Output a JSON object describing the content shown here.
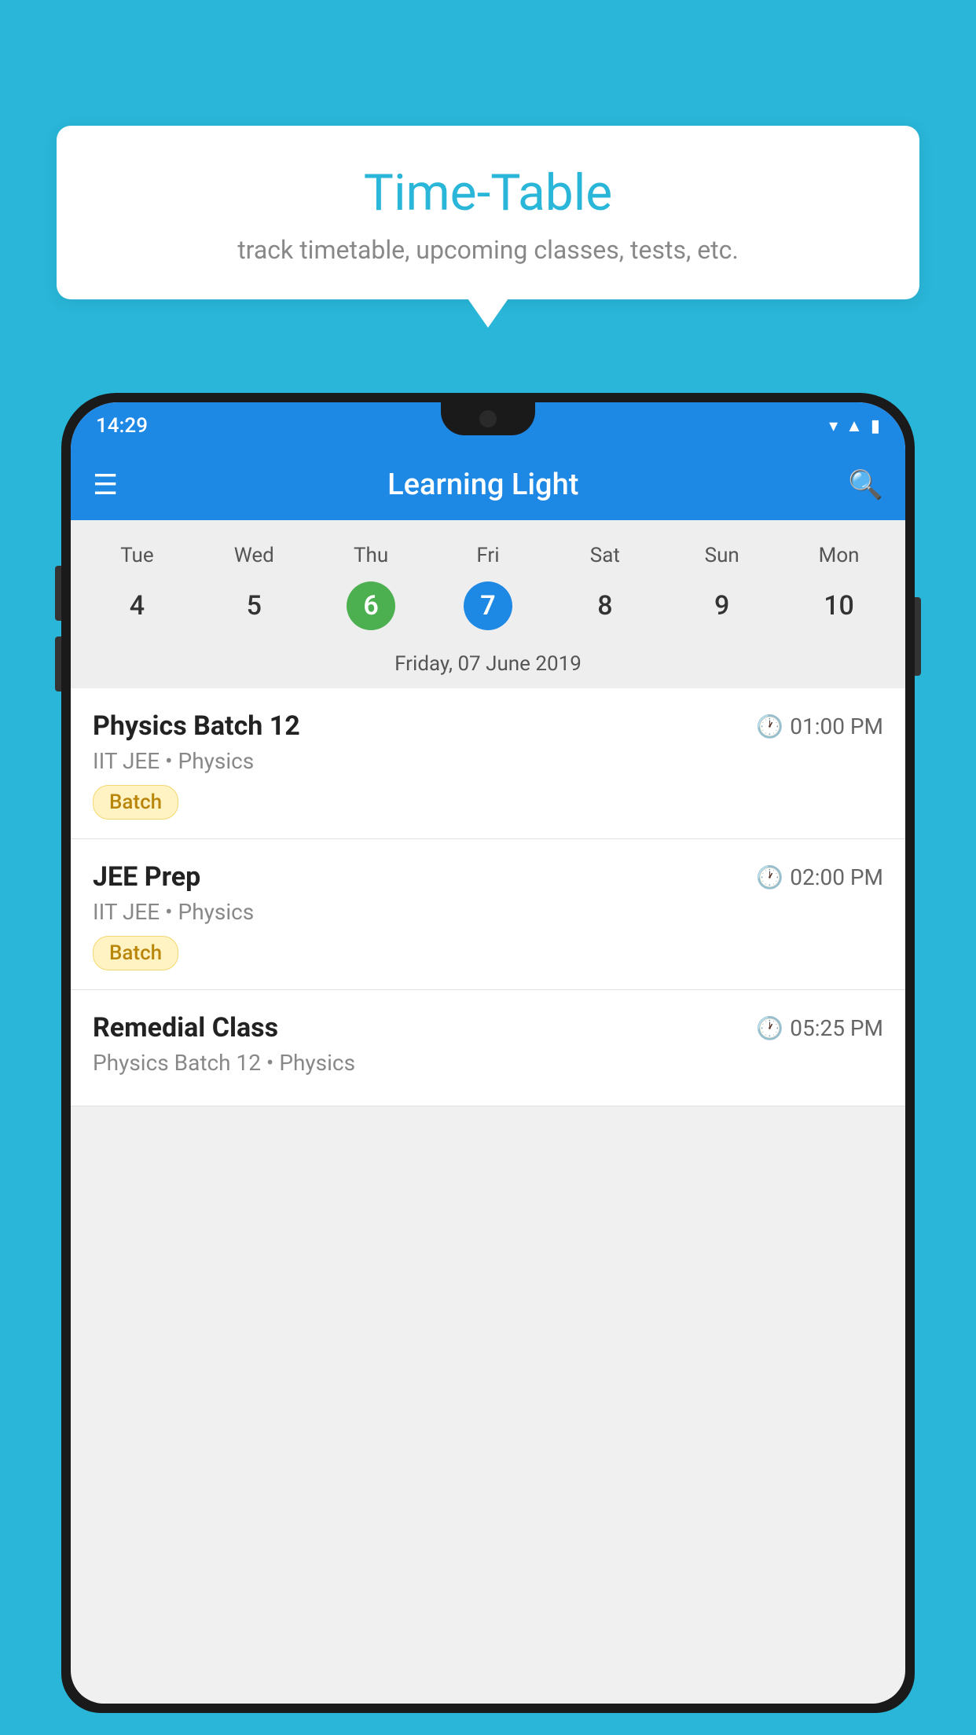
{
  "background_color": "#29b6d8",
  "tooltip": {
    "title": "Time-Table",
    "subtitle": "track timetable, upcoming classes, tests, etc."
  },
  "app": {
    "title": "Learning Light",
    "status_bar": {
      "time": "14:29"
    }
  },
  "calendar": {
    "days": [
      "Tue",
      "Wed",
      "Thu",
      "Fri",
      "Sat",
      "Sun",
      "Mon"
    ],
    "dates": [
      "4",
      "5",
      "6",
      "7",
      "8",
      "9",
      "10"
    ],
    "today_index": 2,
    "selected_index": 3,
    "selected_date_label": "Friday, 07 June 2019"
  },
  "schedule": {
    "items": [
      {
        "title": "Physics Batch 12",
        "time": "01:00 PM",
        "sub": "IIT JEE • Physics",
        "tag": "Batch"
      },
      {
        "title": "JEE Prep",
        "time": "02:00 PM",
        "sub": "IIT JEE • Physics",
        "tag": "Batch"
      },
      {
        "title": "Remedial Class",
        "time": "05:25 PM",
        "sub": "Physics Batch 12 • Physics",
        "tag": ""
      }
    ]
  },
  "icons": {
    "hamburger": "☰",
    "search": "🔍",
    "clock": "🕐"
  }
}
